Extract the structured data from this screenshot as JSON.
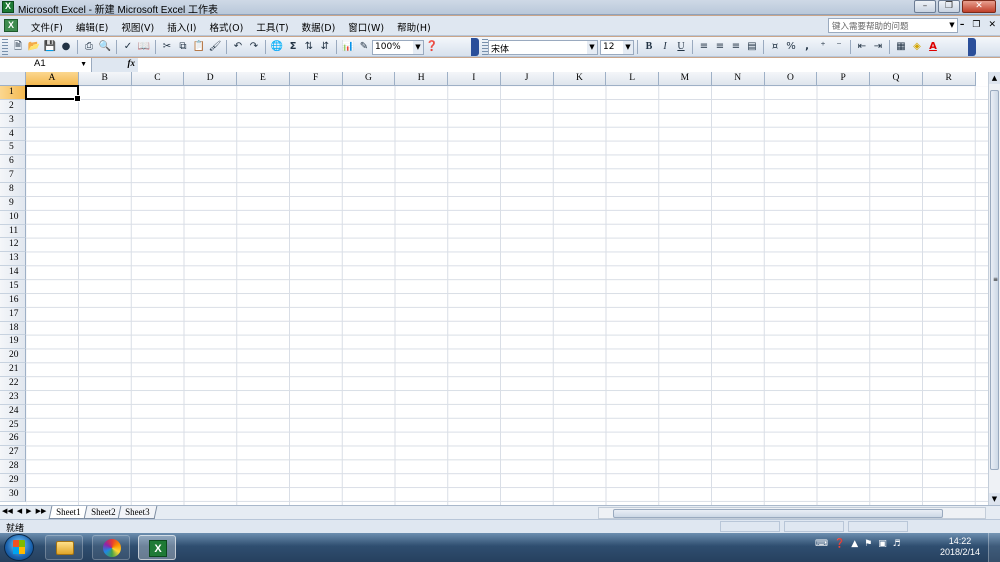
{
  "window": {
    "title": "Microsoft Excel - 新建 Microsoft Excel 工作表",
    "app_icon": "X"
  },
  "menubar": {
    "items": [
      "文件(F)",
      "编辑(E)",
      "视图(V)",
      "插入(I)",
      "格式(O)",
      "工具(T)",
      "数据(D)",
      "窗口(W)",
      "帮助(H)"
    ],
    "help_placeholder": "键入需要帮助的问题"
  },
  "toolbar": {
    "zoom": "100%",
    "font_name": "宋体",
    "font_size": "12",
    "bold": "B",
    "italic": "I",
    "underline": "U",
    "percent": "%",
    "comma": ",",
    "sum": "Σ",
    "font_color_label": "A"
  },
  "formulabar": {
    "name_box": "A1",
    "fx": "fx",
    "formula": ""
  },
  "grid": {
    "columns": [
      "A",
      "B",
      "C",
      "D",
      "E",
      "F",
      "G",
      "H",
      "I",
      "J",
      "K",
      "L",
      "M",
      "N",
      "O",
      "P",
      "Q",
      "R"
    ],
    "rows": [
      "1",
      "2",
      "3",
      "4",
      "5",
      "6",
      "7",
      "8",
      "9",
      "10",
      "11",
      "12",
      "13",
      "14",
      "15",
      "16",
      "17",
      "18",
      "19",
      "20",
      "21",
      "22",
      "23",
      "24",
      "25",
      "26",
      "27",
      "28",
      "29",
      "30"
    ],
    "selected_column": "A",
    "selected_row": "1"
  },
  "sheets": {
    "tabs": [
      "Sheet1",
      "Sheet2",
      "Sheet3"
    ],
    "active": "Sheet1"
  },
  "status": {
    "text": "就绪"
  },
  "taskbar": {
    "time": "14:22",
    "date": "2018/2/14"
  },
  "colors": {
    "selected_header": "#f4b950",
    "gridline": "#d9dee6",
    "excel_green": "#1f7a36"
  }
}
